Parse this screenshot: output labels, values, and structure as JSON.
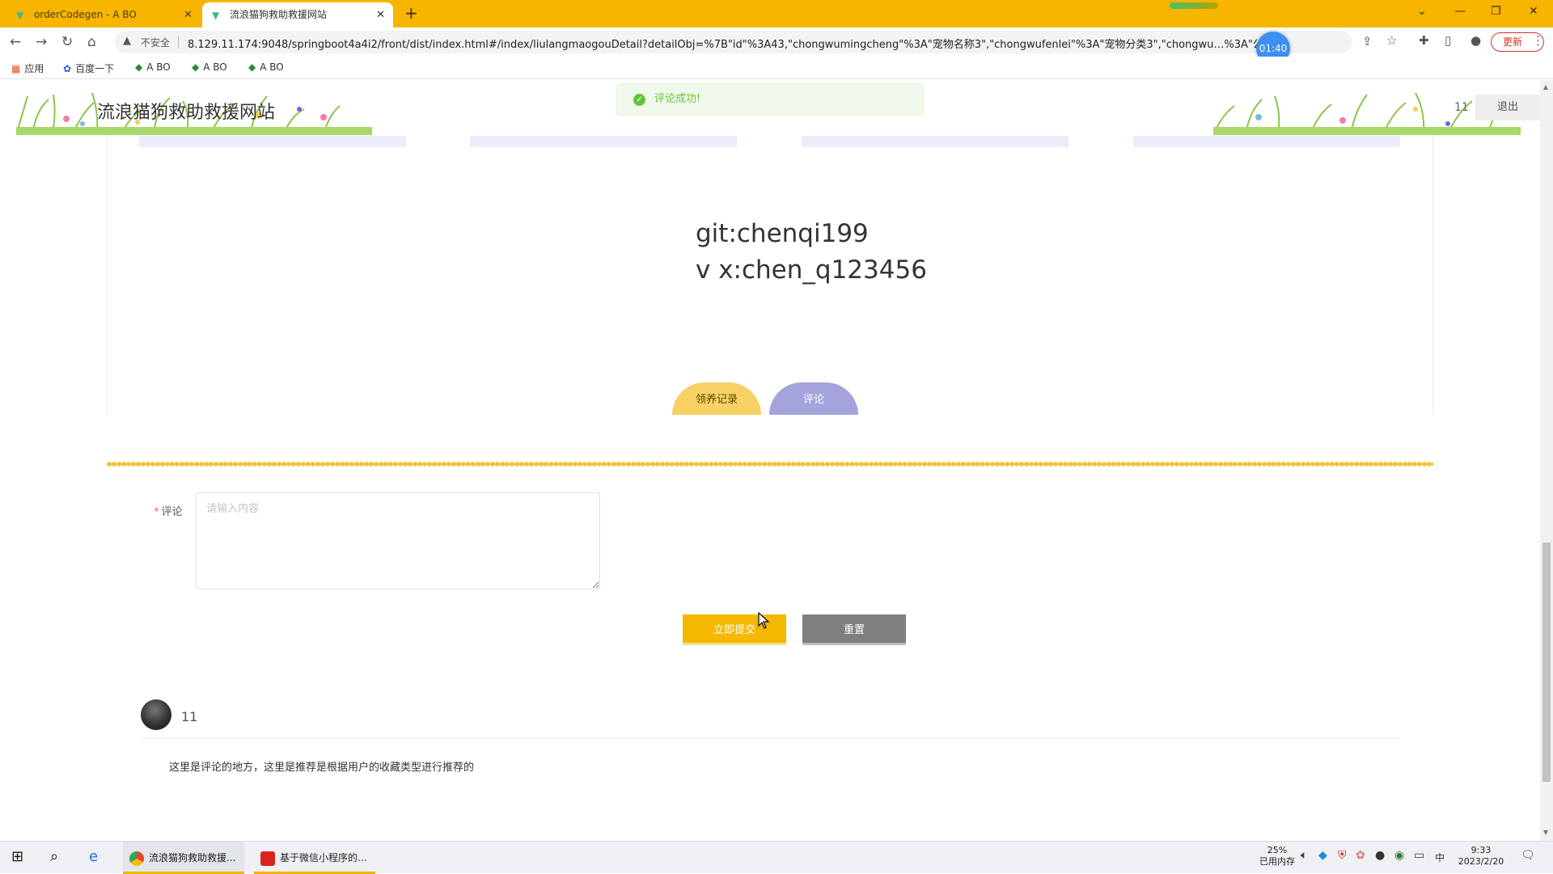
{
  "browser": {
    "tabs": [
      {
        "title": "orderCodegen - A BO",
        "icon": "vue-logo-icon",
        "active": false
      },
      {
        "title": "流浪猫狗救助救援网站",
        "icon": "vue-logo-icon",
        "active": true
      }
    ],
    "new_tab": "+",
    "address": {
      "insecure_label": "不安全",
      "url": "8.129.11.174:9048/springboot4a4i2/front/dist/index.html#/index/liulangmaogouDetail?detailObj=%7B\"id\"%3A43,\"chongwumingcheng\"%3A\"宠物名称3\",\"chongwufenlei\"%3A\"宠物分类3\",\"chongwu…%3A\"公\",..."
    },
    "timer": "01:40",
    "update_button": "更新",
    "bookmarks": [
      {
        "label": "应用",
        "icon": "apps-grid-icon"
      },
      {
        "label": "百度一下",
        "icon": "baidu-paw-icon"
      },
      {
        "label": "A BO",
        "icon": "leaf-icon"
      },
      {
        "label": "A BO",
        "icon": "leaf-icon"
      },
      {
        "label": "A BO",
        "icon": "leaf-icon"
      }
    ]
  },
  "site": {
    "title": "流浪猫狗救助救援网站",
    "user_name": "11",
    "logout": "退出",
    "toast": "评论成功!"
  },
  "detail": {
    "description_lines": [
      "git:chenqi199",
      "v x:chen_q123456"
    ]
  },
  "tabs": {
    "adopt_records": "领养记录",
    "comments": "评论"
  },
  "comment_form": {
    "required_mark": "*",
    "label": "评论",
    "placeholder": "请输入内容",
    "value": "",
    "submit": "立即提交",
    "reset": "重置"
  },
  "comments": [
    {
      "user": "11",
      "text": "这里是评论的地方，这里是推荐是根据用户的收藏类型进行推荐的"
    }
  ],
  "taskbar": {
    "apps": [
      {
        "label": "流浪猫狗救助救援...",
        "active": true,
        "color": "#4285f4"
      },
      {
        "label": "基于微信小程序的...",
        "active": false,
        "color": "#d9241d"
      }
    ],
    "memory_percent": "25%",
    "memory_label": "已用内存",
    "ime": "中",
    "time": "9:33",
    "date": "2023/2/20"
  },
  "colors": {
    "chrome_accent": "#f7b500",
    "submit": "#f5b800",
    "reset": "#7f7f7f",
    "tab_adopt": "#f7d163",
    "tab_comment": "#a5a3dc",
    "success": "#67c23a"
  }
}
